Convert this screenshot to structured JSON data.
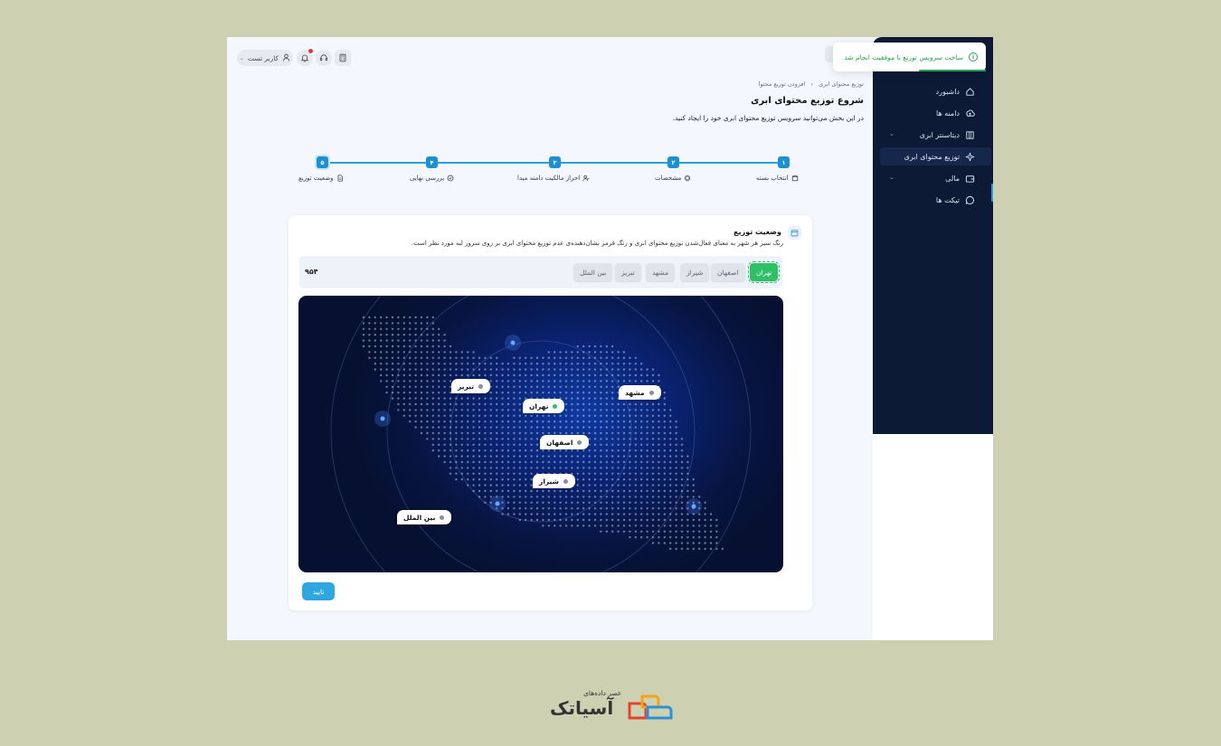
{
  "toast": {
    "message": "ساخت سرویس توزیع با موفقیت انجام شد",
    "color": "#27a44f"
  },
  "topbar": {
    "user_label": "کاربر تست"
  },
  "sidebar": {
    "items": [
      {
        "label": "داشبورد",
        "icon": "home-icon"
      },
      {
        "label": "دامنه ها",
        "icon": "cloud-upload-icon"
      },
      {
        "label": "دیتاسنتر ابری",
        "icon": "building-icon",
        "expandable": true
      },
      {
        "label": "توزیع محتوای ابری",
        "icon": "sparkle-icon",
        "active": true
      },
      {
        "label": "مالی",
        "icon": "wallet-icon",
        "expandable": true
      },
      {
        "label": "تیکت ها",
        "icon": "chat-icon"
      }
    ]
  },
  "breadcrumb": {
    "root": "توزیع محتوای ابری",
    "separator": "‹",
    "current": "افزودن توزیع محتوا"
  },
  "header": {
    "title": "شروع توزیع محتوای ابری",
    "description": "در این بخش می‌توانید سرویس توزیع محتوای ابری خود را ایجاد کنید."
  },
  "steps": [
    {
      "number": "۱",
      "label": "انتخاب بسته",
      "icon": "box-icon"
    },
    {
      "number": "۲",
      "label": "مشخصات",
      "icon": "chip-icon"
    },
    {
      "number": "۳",
      "label": "احراز مالکیت دامنه مبدا",
      "icon": "user-check-icon"
    },
    {
      "number": "۴",
      "label": "بررسی نهایی",
      "icon": "check-circle-icon"
    },
    {
      "number": "۵",
      "label": "وضعیت توزیع",
      "icon": "document-icon"
    }
  ],
  "card": {
    "title": "وضعیت توزیع",
    "description": "رنگ سبز هر شهر به معنای فعال‌شدن توزیع محتوای ابری و رنگ قرمز نشان‌دهنده‌ی عدم توزیع محتوای ابری بر روی سرور لبه مورد نظر است."
  },
  "cities": {
    "chips": [
      {
        "label": "تهران",
        "active": true
      },
      {
        "label": "اصفهان",
        "active": false
      },
      {
        "label": "شیراز",
        "active": false
      },
      {
        "label": "مشهد",
        "active": false
      },
      {
        "label": "تبریز",
        "active": false
      },
      {
        "label": "بین الملل",
        "active": false
      }
    ],
    "count": "۹۵۴"
  },
  "map_pins": {
    "tabriz": "تبریز",
    "mashhad": "مشهد",
    "tehran": "تهران",
    "isfahan": "اصفهان",
    "shiraz": "شیراز",
    "international": "بین الملل"
  },
  "actions": {
    "confirm": "تایید"
  },
  "colors": {
    "accent": "#2ea6e0",
    "active_green": "#2fbf65",
    "sidebar_bg": "#0c1a36"
  },
  "footer_logo": {
    "tagline": "عصر داده‌های",
    "brand": "آسیاتک"
  }
}
